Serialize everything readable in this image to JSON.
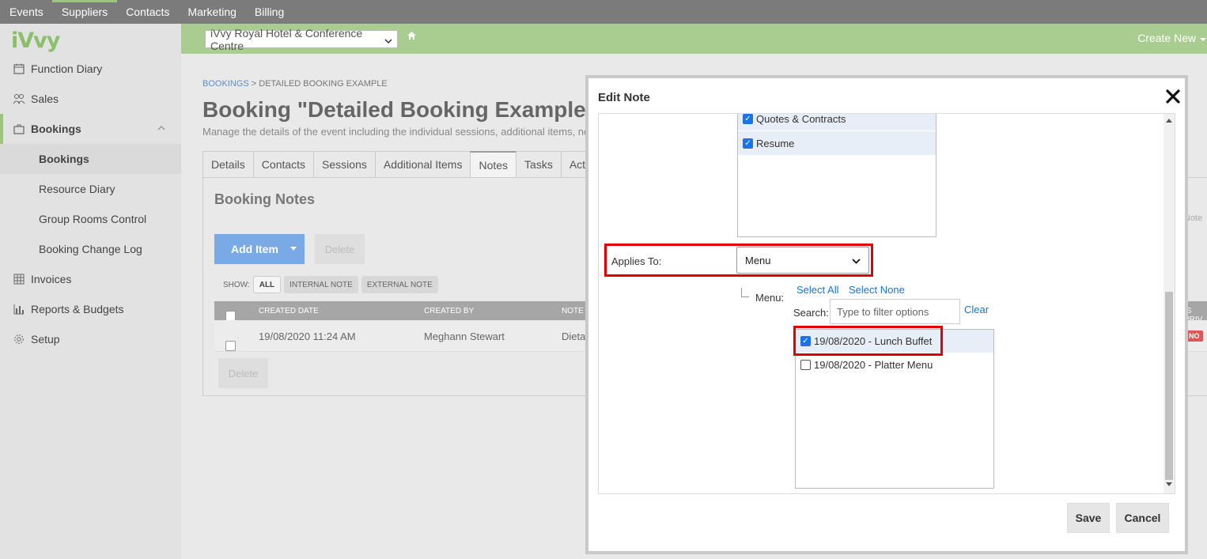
{
  "topnav": {
    "items": [
      "Events",
      "Suppliers",
      "Contacts",
      "Marketing",
      "Billing"
    ],
    "active": "Suppliers"
  },
  "brand": {
    "logo": "iVvy",
    "accent": "#9cc57e"
  },
  "sidebar": {
    "items": [
      {
        "label": "Function Diary",
        "icon": "calendar-icon"
      },
      {
        "label": "Sales",
        "icon": "people-icon"
      },
      {
        "label": "Bookings",
        "icon": "briefcase-icon"
      },
      {
        "label": "Bookings"
      },
      {
        "label": "Resource Diary"
      },
      {
        "label": "Group Rooms Control"
      },
      {
        "label": "Booking Change Log"
      },
      {
        "label": "Invoices",
        "icon": "grid-icon"
      },
      {
        "label": "Reports & Budgets",
        "icon": "bar-chart-icon"
      },
      {
        "label": "Setup",
        "icon": "gear-icon"
      }
    ]
  },
  "header": {
    "venue": "iVvy Royal Hotel & Conference Centre",
    "create_new": "Create New"
  },
  "page": {
    "breadcrumb_link": "BOOKINGS",
    "breadcrumb_sep": ">",
    "breadcrumb_current": "DETAILED BOOKING EXAMPLE",
    "title": "Booking \"Detailed Booking Example\"",
    "subtitle": "Manage the details of the event including the individual sessions, additional items, no",
    "tabs": [
      "Details",
      "Contacts",
      "Sessions",
      "Additional Items",
      "Notes",
      "Tasks",
      "Activities"
    ],
    "active_tab": "Notes"
  },
  "notes": {
    "title": "Booking Notes",
    "add_item": "Add Item",
    "delete": "Delete",
    "show_label": "SHOW:",
    "filters": [
      "ALL",
      "INTERNAL NOTE",
      "EXTERNAL NOTE"
    ],
    "columns": [
      "CREATED DATE",
      "CREATED BY",
      "NOTE"
    ],
    "rows": [
      {
        "created_date": "19/08/2020 11:24 AM",
        "created_by": "Meghann Stewart",
        "note": "Dietary",
        "private": "NO"
      }
    ],
    "right_col_hint": "Note",
    "right_col_header": "IS PRIV"
  },
  "modal": {
    "title": "Edit Note",
    "list1": [
      {
        "label": "Quotes & Contracts",
        "checked": true
      },
      {
        "label": "Resume",
        "checked": true
      }
    ],
    "applies_to_label": "Applies To:",
    "applies_to_value": "Menu",
    "menu_label": "Menu:",
    "select_all": "Select All",
    "select_none": "Select None",
    "search_label": "Search:",
    "search_placeholder": "Type to filter options",
    "clear": "Clear",
    "menu_options": [
      {
        "label": "19/08/2020 - Lunch Buffet",
        "checked": true
      },
      {
        "label": "19/08/2020 - Platter Menu",
        "checked": false
      }
    ],
    "save": "Save",
    "cancel": "Cancel"
  }
}
